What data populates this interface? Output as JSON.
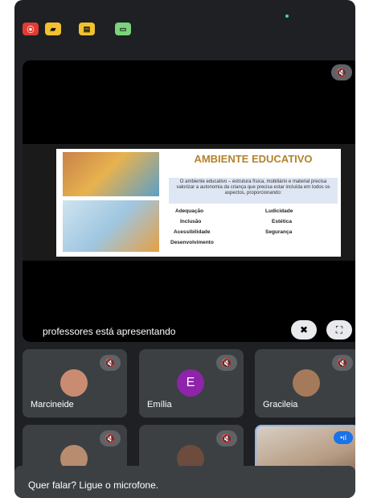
{
  "top_buttons": [
    {
      "icon": "record-icon",
      "glyph": "⦿",
      "color": "#e33b32"
    },
    {
      "icon": "camera-off-icon",
      "glyph": "▰",
      "color": "#f2c12e"
    },
    {
      "icon": "sidebar-icon",
      "glyph": "▤",
      "color": "#f2c12e"
    },
    {
      "icon": "display-icon",
      "glyph": "▭",
      "color": "#7bd37b"
    }
  ],
  "stage": {
    "presenting_text": "professores está apresentando",
    "pin_icon": "pin-off-icon",
    "fullscreen_icon": "fullscreen-icon"
  },
  "slide": {
    "title": "AMBIENTE EDUCATIVO",
    "description": "O ambiente educativo – estrutura física, mobiliário e material precisa valorizar a autonomia da criança que precisa estar incluída em todos os aspectos, proporcionando:",
    "keywords": {
      "left": [
        "Adequação",
        "Inclusão",
        "Acessibilidade",
        "Desenvolvimento"
      ],
      "right": [
        "Ludicidade",
        "Estética",
        "Segurança"
      ]
    }
  },
  "participants": [
    {
      "name": "Marcineide",
      "avatar": "photo",
      "avatar_color": "#c98c73",
      "muted": true
    },
    {
      "name": "Emília",
      "avatar": "E",
      "avatar_color": "#8e24aa",
      "muted": true
    },
    {
      "name": "Gracileia",
      "avatar": "photo",
      "avatar_color": "#a57a5a",
      "muted": true
    },
    {
      "name": "",
      "avatar": "photo",
      "avatar_color": "#b88c6e",
      "muted": true
    },
    {
      "name": "",
      "avatar": "photo",
      "avatar_color": "#6d4c3d",
      "muted": true
    }
  ],
  "toast": {
    "text": "Quer falar? Ligue o microfone."
  }
}
